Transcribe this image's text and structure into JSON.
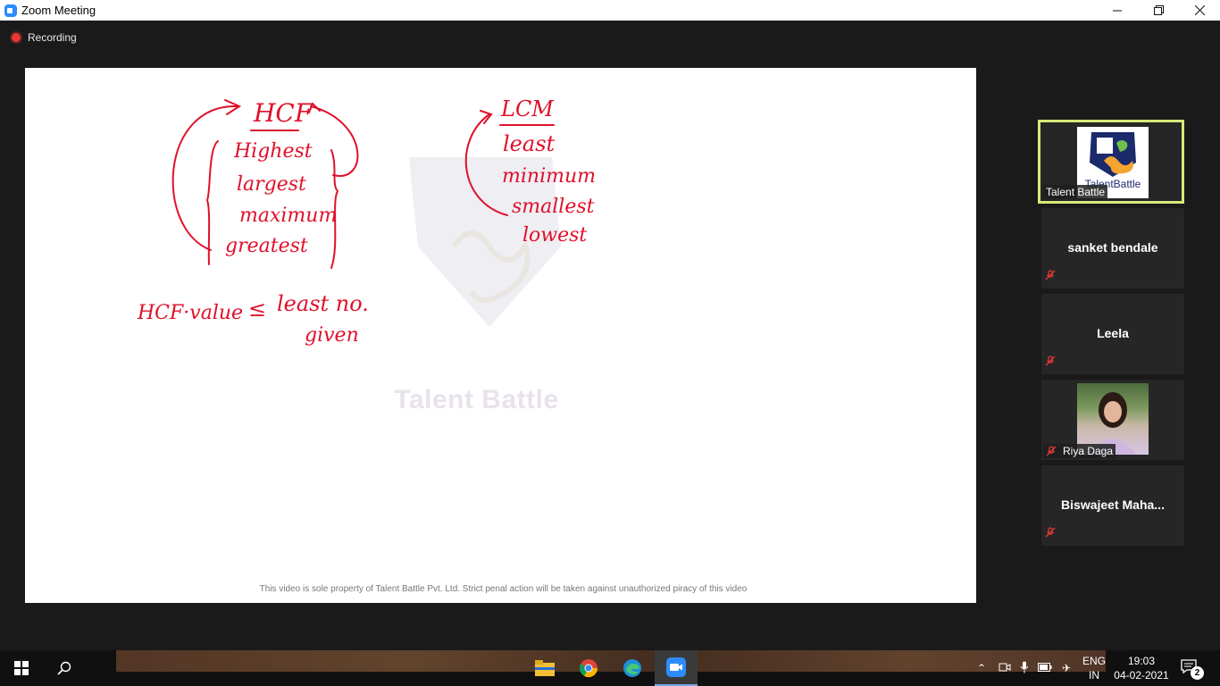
{
  "window": {
    "title": "Zoom Meeting",
    "controls": {
      "minimize": "—",
      "maximize": "❐",
      "close": "✕"
    }
  },
  "recording": {
    "label": "Recording"
  },
  "share": {
    "watermark": "Talent Battle",
    "footer_note": "This video is sole property of Talent Battle Pvt. Ltd. Strict penal action will be taken against unauthorized piracy of this video",
    "handwriting": {
      "hcf_title": "HCF",
      "hcf_words": [
        "Highest",
        "largest",
        "maximum",
        "greatest"
      ],
      "hcf_rule_left": "HCF·value",
      "hcf_rule_sign": "≤",
      "hcf_rule_right": "least no.",
      "hcf_rule_right2": "given",
      "lcm_title": "LCM",
      "lcm_words": [
        "least",
        "minimum",
        "smallest",
        "lowest"
      ]
    },
    "ink_color": "#e0102a"
  },
  "participants": [
    {
      "name": "Talent Battle",
      "logo_text": "TalentBattle",
      "active": true
    },
    {
      "name": "sanket bendale",
      "muted": true
    },
    {
      "name": "Leela",
      "muted": true
    },
    {
      "name": "Riya Daga",
      "muted": true
    },
    {
      "name": "Biswajeet  Maha...",
      "muted": true
    }
  ],
  "taskbar": {
    "apps": [
      "start-icon",
      "search-icon",
      "file-explorer-icon",
      "chrome-icon",
      "edge-icon",
      "zoom-icon"
    ],
    "language": [
      "ENG",
      "IN"
    ],
    "time": "19:03",
    "date": "04-02-2021",
    "notification_count": "2"
  }
}
